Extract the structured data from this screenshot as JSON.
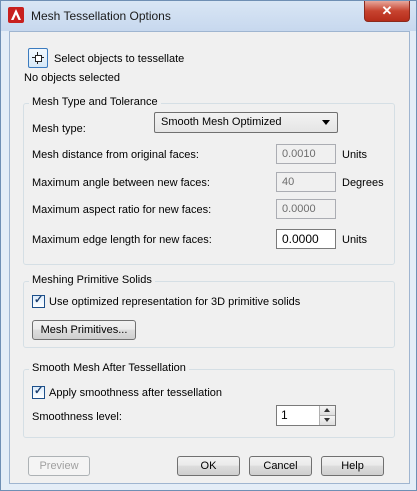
{
  "window": {
    "title": "Mesh Tessellation Options",
    "close_label": "✕"
  },
  "select": {
    "label": "Select objects to tessellate",
    "status": "No objects selected"
  },
  "mesh_type_group": {
    "title": "Mesh Type and Tolerance",
    "mesh_type_label": "Mesh type:",
    "mesh_type_value": "Smooth Mesh Optimized",
    "distance_label": "Mesh distance from original faces:",
    "distance_value": "0.0010",
    "distance_unit": "Units",
    "angle_label": "Maximum angle between new faces:",
    "angle_value": "40",
    "angle_unit": "Degrees",
    "aspect_label": "Maximum aspect ratio for new faces:",
    "aspect_value": "0.0000",
    "edge_label": "Maximum edge length for new faces:",
    "edge_value": "0.0000",
    "edge_unit": "Units"
  },
  "primitive_group": {
    "title": "Meshing Primitive Solids",
    "optimized_label": "Use optimized representation for 3D primitive solids",
    "optimized_checked": true,
    "primitives_button": "Mesh Primitives..."
  },
  "smooth_group": {
    "title": "Smooth Mesh After Tessellation",
    "apply_label": "Apply smoothness after tessellation",
    "apply_checked": true,
    "level_label": "Smoothness level:",
    "level_value": "1"
  },
  "footer": {
    "preview": "Preview",
    "ok": "OK",
    "cancel": "Cancel",
    "help": "Help"
  }
}
